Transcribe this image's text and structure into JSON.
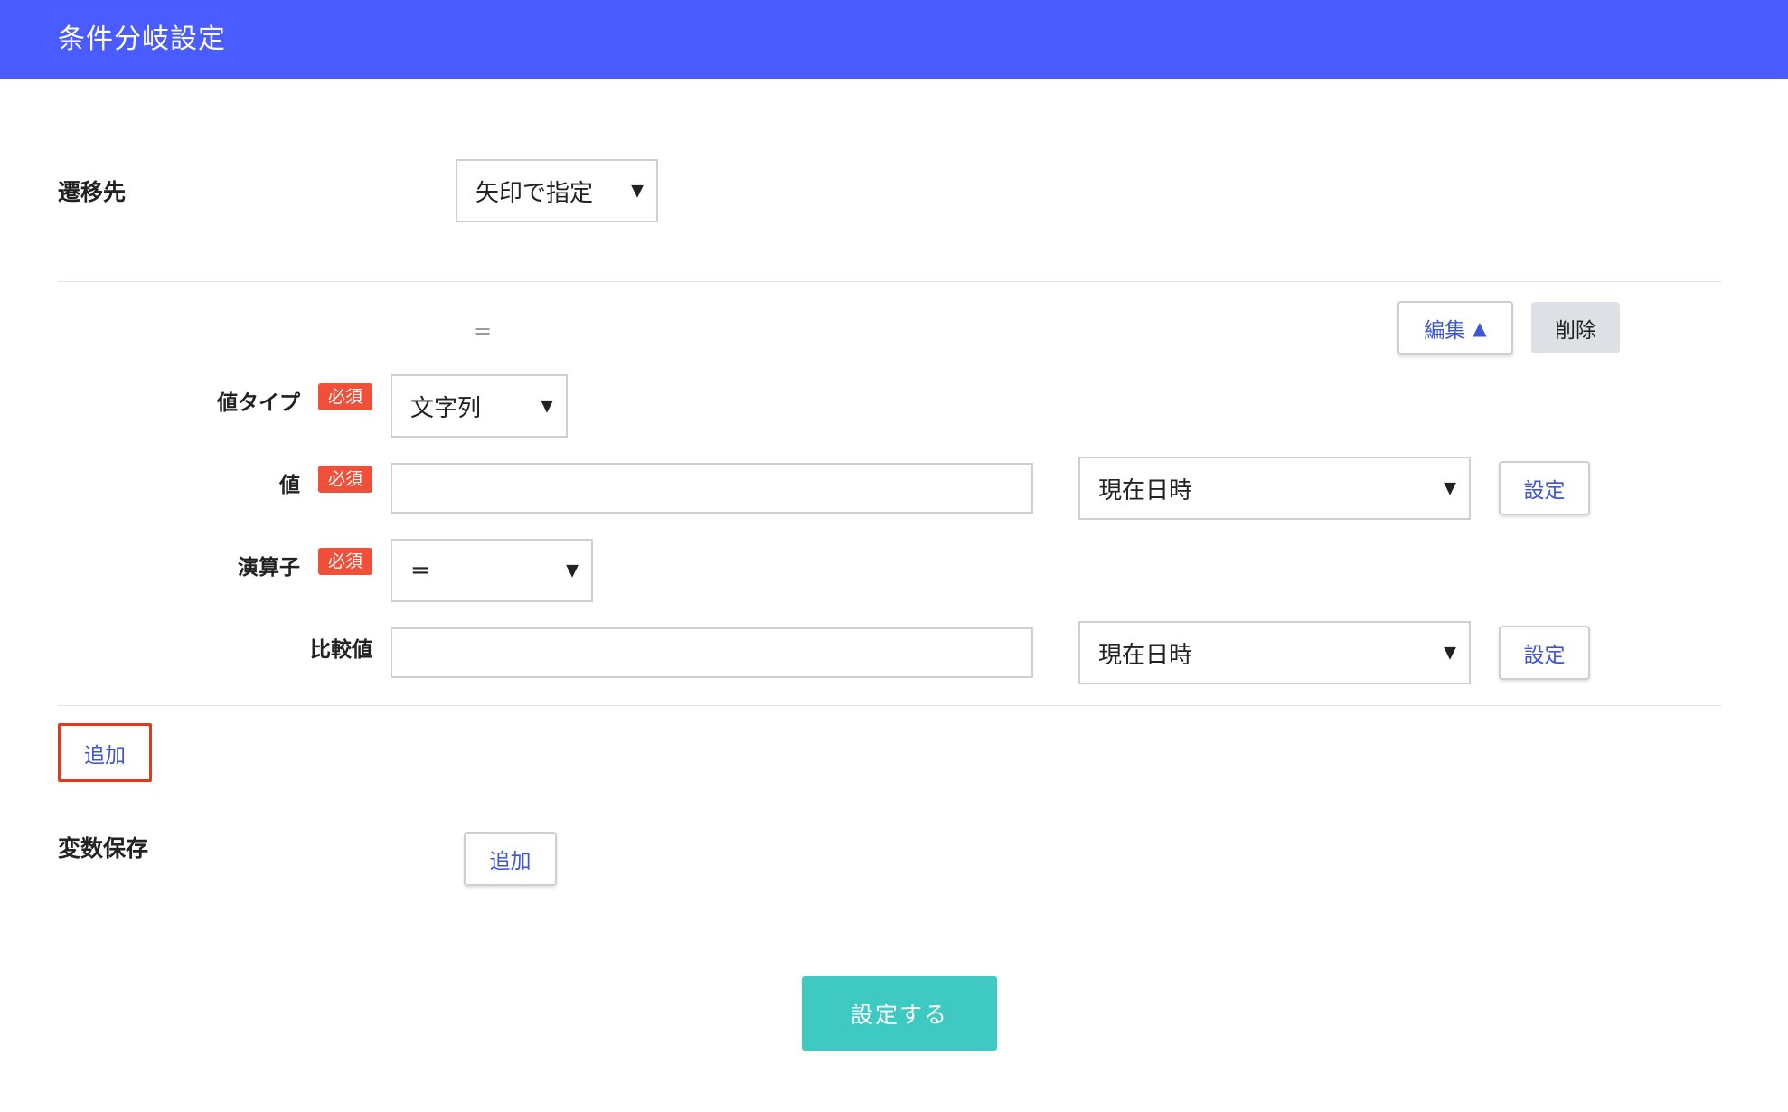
{
  "header": {
    "title": "条件分岐設定"
  },
  "transition": {
    "label": "遷移先",
    "select_value": "矢印で指定"
  },
  "condition": {
    "summary": "=",
    "edit_label": "編集",
    "delete_label": "削除",
    "value_type": {
      "label": "値タイプ",
      "required": "必須",
      "select_value": "文字列"
    },
    "value": {
      "label": "値",
      "required": "必須",
      "input_value": "",
      "source_select_value": "現在日時",
      "set_label": "設定"
    },
    "operator": {
      "label": "演算子",
      "required": "必須",
      "select_value": "="
    },
    "compare_value": {
      "label": "比較値",
      "input_value": "",
      "source_select_value": "現在日時",
      "set_label": "設定"
    }
  },
  "add_condition_label": "追加",
  "variable_save": {
    "label": "変数保存",
    "add_label": "追加"
  },
  "submit_label": "設定する",
  "colors": {
    "header": "#4a5cff",
    "required_badge": "#f0503a",
    "submit": "#3ec9c2",
    "link_text": "#3c54d8",
    "highlight": "#e03a1e"
  },
  "icons": {
    "dropdown": "caret-down-icon",
    "collapse": "triangle-up-icon"
  }
}
